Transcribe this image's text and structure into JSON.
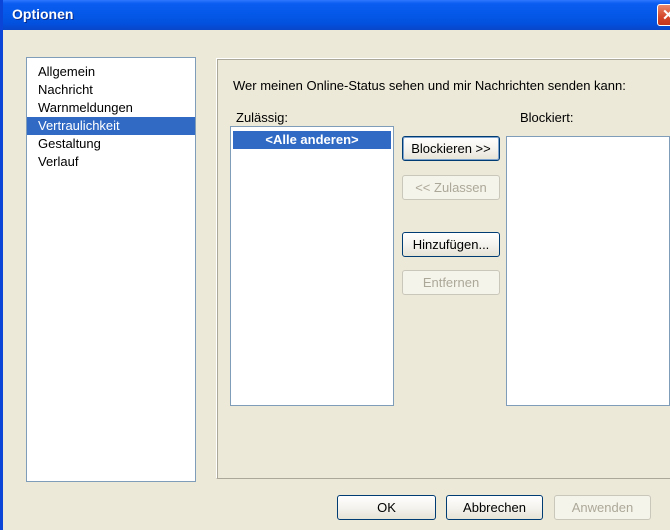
{
  "window": {
    "title": "Optionen"
  },
  "nav": {
    "items": [
      {
        "label": "Allgemein"
      },
      {
        "label": "Nachricht"
      },
      {
        "label": "Warnmeldungen"
      },
      {
        "label": "Vertraulichkeit",
        "selected": true
      },
      {
        "label": "Gestaltung"
      },
      {
        "label": "Verlauf"
      }
    ]
  },
  "privacy": {
    "description": "Wer meinen Online-Status sehen und mir Nachrichten senden kann:",
    "allowed_label": "Zulässig:",
    "blocked_label": "Blockiert:",
    "allowed_items": [
      "<Alle anderen>"
    ],
    "blocked_items": [],
    "block_button": "Blockieren >>",
    "allow_button": "<< Zulassen",
    "add_button": "Hinzufügen...",
    "remove_button": "Entfernen"
  },
  "footer": {
    "ok": "OK",
    "cancel": "Abbrechen",
    "apply": "Anwenden"
  },
  "colors": {
    "titlebar": "#0458e8",
    "selection": "#316ac5",
    "dialog_bg": "#ece9d8"
  }
}
